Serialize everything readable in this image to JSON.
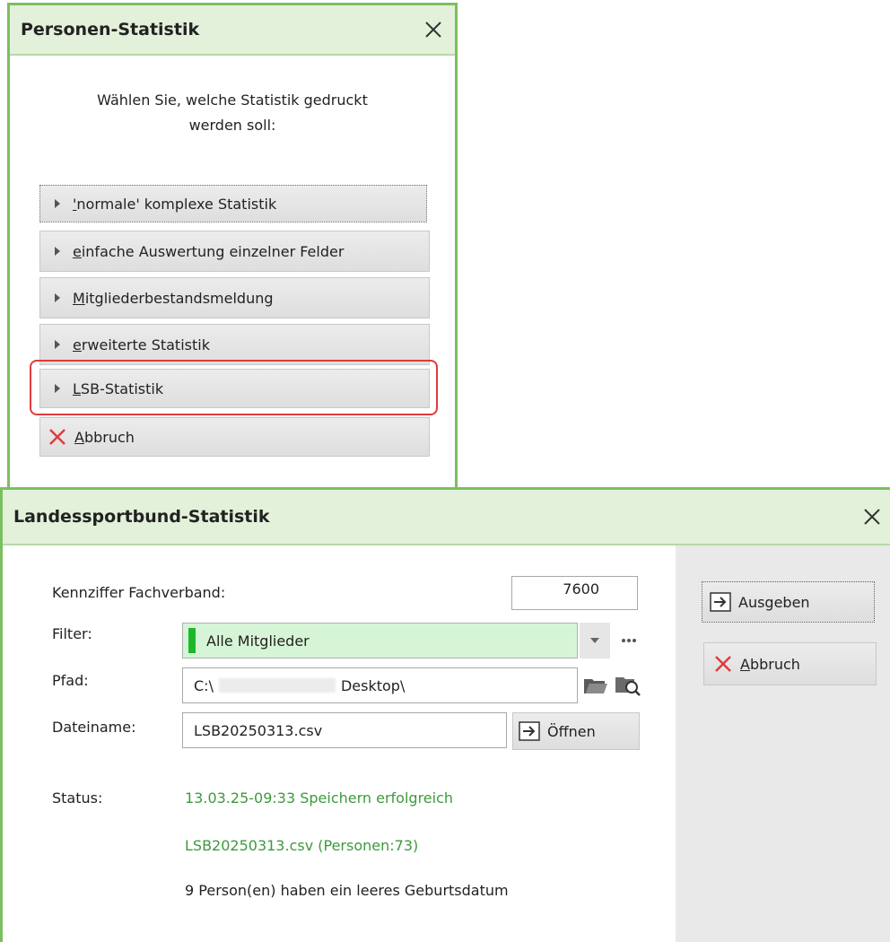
{
  "dialog1": {
    "title": "Personen-Statistik",
    "prompt_line1": "Wählen Sie, welche Statistik gedruckt",
    "prompt_line2": "werden soll:",
    "options": [
      {
        "first": "'",
        "rest": "normale' komplexe Statistik"
      },
      {
        "first": "e",
        "rest": "infache Auswertung einzelner Felder"
      },
      {
        "first": "M",
        "rest": "itgliederbestandsmeldung"
      },
      {
        "first": "e",
        "rest": "rweiterte Statistik"
      },
      {
        "first": "L",
        "rest": "SB-Statistik"
      }
    ],
    "cancel": {
      "first": "A",
      "rest": "bbruch"
    }
  },
  "dialog2": {
    "title": "Landessportbund-Statistik",
    "kennziffer_label": "Kennziffer Fachverband:",
    "kennziffer_value": "7600",
    "filter_label": "Filter:",
    "filter_value": "Alle Mitglieder",
    "pfad_label": "Pfad:",
    "pfad_prefix": "C:\\",
    "pfad_suffix": "Desktop\\",
    "dateiname_label": "Dateiname:",
    "dateiname_value": "LSB20250313.csv",
    "open_button": "Öffnen",
    "status_label": "Status:",
    "status_line1": "13.03.25-09:33 Speichern erfolgreich",
    "status_line2": "LSB20250313.csv (Personen:73)",
    "status_line3": "9 Person(en) haben ein leeres Geburtsdatum",
    "ausgeben_button": "Ausgeben",
    "abbruch_first": "A",
    "abbruch_rest": "bbruch"
  },
  "colors": {
    "accent_green": "#7cbf5f",
    "status_green": "#3d9a3d",
    "highlight_red": "#e03b3b"
  }
}
